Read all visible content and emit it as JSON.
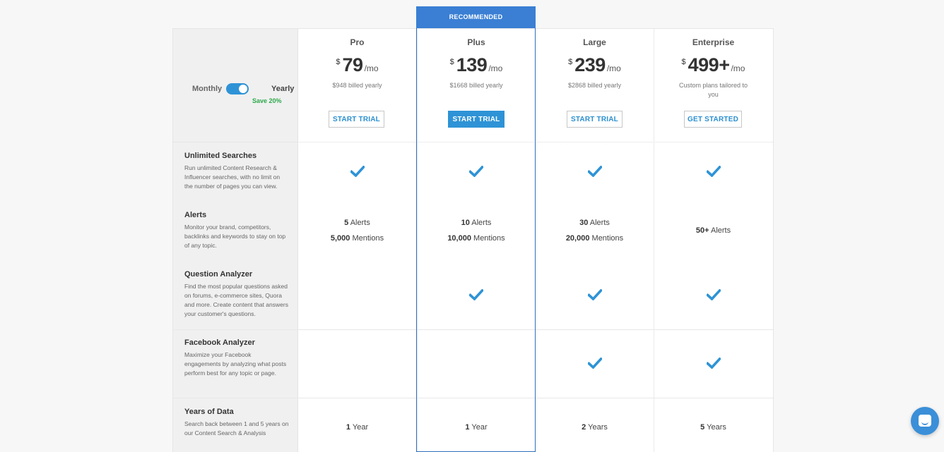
{
  "recommended_label": "RECOMMENDED",
  "toggle": {
    "monthly_label": "Monthly",
    "yearly_label": "Yearly",
    "save_label": "Save 20%",
    "state": "yearly"
  },
  "plans": [
    {
      "name": "Pro",
      "currency": "$",
      "price": "79",
      "per": "/mo",
      "billed": "$948 billed yearly",
      "cta": "START TRIAL"
    },
    {
      "name": "Plus",
      "currency": "$",
      "price": "139",
      "per": "/mo",
      "billed": "$1668 billed yearly",
      "cta": "START TRIAL"
    },
    {
      "name": "Large",
      "currency": "$",
      "price": "239",
      "per": "/mo",
      "billed": "$2868 billed yearly",
      "cta": "START TRIAL"
    },
    {
      "name": "Enterprise",
      "currency": "$",
      "price": "499+",
      "per": "/mo",
      "billed": "Custom plans tailored to you",
      "cta": "GET STARTED"
    }
  ],
  "features": [
    {
      "title": "Unlimited Searches",
      "desc": "Run unlimited Content Research & Influencer searches, with no limit on the number of pages you can view."
    },
    {
      "title": "Alerts",
      "desc": "Monitor your brand, competitors, backlinks and keywords to stay on top of any topic."
    },
    {
      "title": "Question Analyzer",
      "desc": "Find the most popular questions asked on forums, e-commerce sites, Quora and more. Create content that answers your customer's questions."
    },
    {
      "title": "Facebook Analyzer",
      "desc": "Maximize your Facebook engagements by analyzing what posts perform best for any topic or page."
    },
    {
      "title": "Years of Data",
      "desc": "Search back between 1 and 5 years on our Content Search & Analysis"
    }
  ],
  "alerts": {
    "pro": {
      "alerts_num": "5",
      "alerts_label": "Alerts",
      "mentions_num": "5,000",
      "mentions_label": "Mentions"
    },
    "plus": {
      "alerts_num": "10",
      "alerts_label": "Alerts",
      "mentions_num": "10,000",
      "mentions_label": "Mentions"
    },
    "large": {
      "alerts_num": "30",
      "alerts_label": "Alerts",
      "mentions_num": "20,000",
      "mentions_label": "Mentions"
    },
    "enterprise": {
      "alerts_num": "50+",
      "alerts_label": "Alerts"
    }
  },
  "years": {
    "pro": {
      "num": "1",
      "label": "Year"
    },
    "plus": {
      "num": "1",
      "label": "Year"
    },
    "large": {
      "num": "2",
      "label": "Years"
    },
    "enterprise": {
      "num": "5",
      "label": "Years"
    }
  },
  "colors": {
    "accent": "#2e93d6",
    "recommended": "#3a7fd4",
    "check": "#2e93d6",
    "save": "#2ba84a"
  },
  "icons": {
    "check": "check-icon",
    "chat": "chat-icon"
  }
}
